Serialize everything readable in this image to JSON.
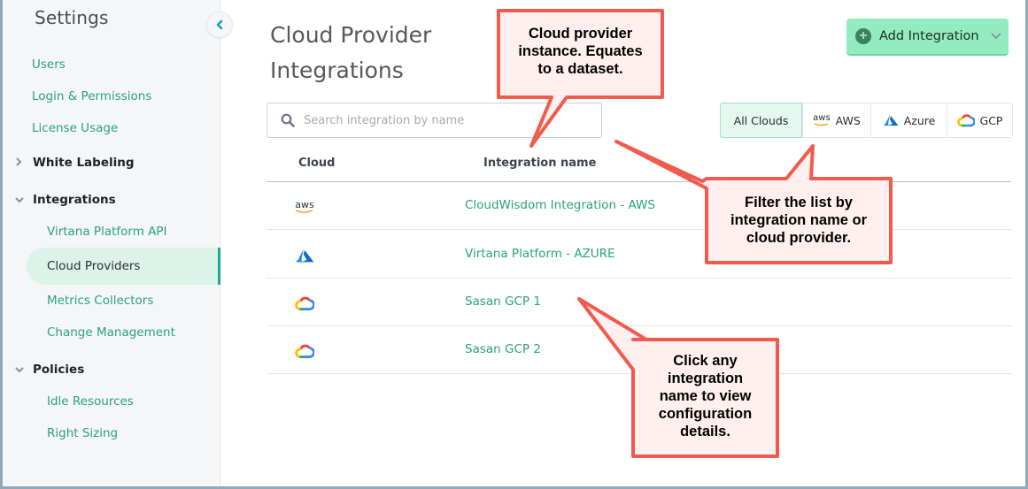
{
  "sidebar": {
    "title": "Settings",
    "items": [
      {
        "label": "Users"
      },
      {
        "label": "Login & Permissions"
      },
      {
        "label": "License Usage"
      }
    ],
    "sections": [
      {
        "label": "White Labeling",
        "expanded": false
      },
      {
        "label": "Integrations",
        "expanded": true,
        "children": [
          {
            "label": "Virtana Platform API"
          },
          {
            "label": "Cloud Providers",
            "active": true
          },
          {
            "label": "Metrics Collectors"
          },
          {
            "label": "Change Management"
          }
        ]
      },
      {
        "label": "Policies",
        "expanded": true,
        "children": [
          {
            "label": "Idle Resources"
          },
          {
            "label": "Right Sizing"
          }
        ]
      }
    ],
    "collapse_icon": "chevron-left-icon"
  },
  "main": {
    "title": "Cloud Provider Integrations",
    "add_button": {
      "label": "Add Integration",
      "icon": "plus-circle-icon",
      "caret": "chevron-down-icon"
    },
    "search": {
      "placeholder": "Search integration by name",
      "value": "",
      "icon": "search-icon"
    },
    "filters": [
      {
        "label": "All Clouds",
        "active": true,
        "icon": ""
      },
      {
        "label": "AWS",
        "active": false,
        "icon": "aws-logo-icon",
        "logo_text": "aws"
      },
      {
        "label": "Azure",
        "active": false,
        "icon": "azure-logo-icon"
      },
      {
        "label": "GCP",
        "active": false,
        "icon": "gcp-logo-icon"
      }
    ],
    "table": {
      "columns": [
        "Cloud",
        "Integration name"
      ],
      "rows": [
        {
          "cloud": "aws",
          "cloud_logo_text": "aws",
          "name": "CloudWisdom Integration - AWS"
        },
        {
          "cloud": "azure",
          "name": "Virtana Platform - AZURE"
        },
        {
          "cloud": "gcp",
          "name": "Sasan GCP 1"
        },
        {
          "cloud": "gcp",
          "name": "Sasan GCP 2"
        }
      ]
    }
  },
  "callouts": [
    {
      "lines": [
        "Cloud provider",
        "instance. Equates",
        "to a dataset."
      ]
    },
    {
      "lines": [
        "Filter the list by",
        "integration name or",
        "cloud provider."
      ]
    },
    {
      "lines": [
        "Click any",
        "integration",
        "name to view",
        "configuration",
        "details."
      ]
    }
  ],
  "colors": {
    "accent_green": "#27a37d",
    "add_button_bg": "#92ecc0",
    "active_nav_bg": "#dcf3ea",
    "active_nav_bar": "#1aa89a",
    "callout_border": "#f25a4d",
    "callout_fill": "#fff0ef",
    "window_border": "#8fa9ba"
  }
}
